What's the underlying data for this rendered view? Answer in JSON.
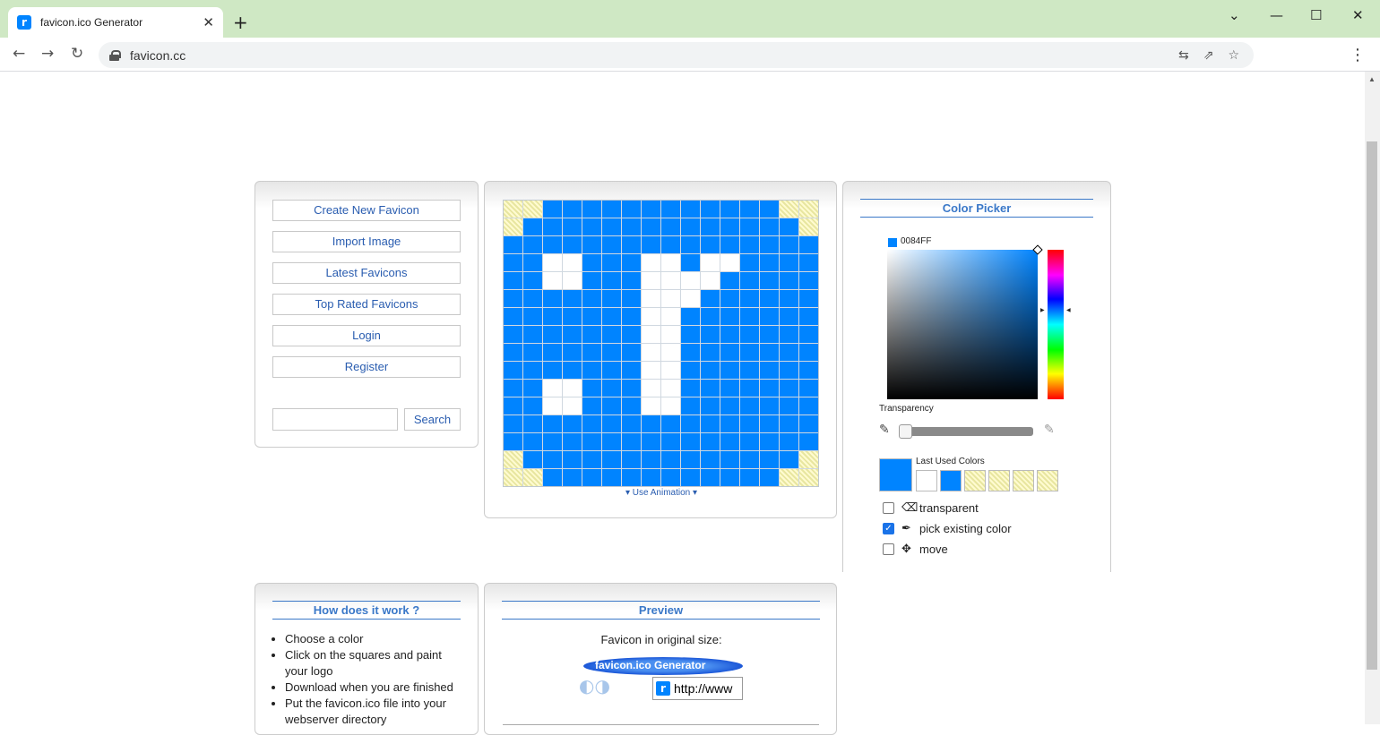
{
  "browser": {
    "tab_title": "favicon.ico Generator",
    "tab_favicon_letter": "r",
    "tab_close": "✕",
    "new_tab": "+",
    "url": "favicon.cc",
    "window_controls": {
      "tabsearch": "⌄",
      "minimize": "—",
      "maximize": "☐",
      "close": "✕"
    },
    "nav": {
      "back": "←",
      "forward": "→",
      "reload": "↻"
    },
    "omnibox_icons": [
      "translate-icon",
      "share-icon",
      "star-icon"
    ],
    "menu": "⋮"
  },
  "menu": {
    "items": [
      "Create New Favicon",
      "Import Image",
      "Latest Favicons",
      "Top Rated Favicons",
      "Login",
      "Register"
    ],
    "search_button": "Search",
    "search_value": ""
  },
  "editor": {
    "use_animation": "Use Animation",
    "pixels": [
      "TTBBBBBBBBBBBBTT",
      "TBBBBBBBBBBBBBBT",
      "BBBBBBBBBBBBBBBB",
      "BBWWBBBWWBWWBBBB",
      "BBWWBBBWWWWBBBBB",
      "BBBBBBBWWWBBBBBB",
      "BBBBBBBWWBBBBBBB",
      "BBBBBBBWWBBBBBBB",
      "BBBBBBBWWBBBBBBB",
      "BBBBBBBWWBBBBBBB",
      "BBWWBBBWWBBBBBBB",
      "BBWWBBBWWBBBBBBB",
      "BBBBBBBBBBBBBBBB",
      "BBBBBBBBBBBBBBBB",
      "TBBBBBBBBBBBBBBT",
      "TTBBBBBBBBBBBBTT"
    ],
    "colors": {
      "B": "#0084ff",
      "W": "#ffffff"
    }
  },
  "color_picker": {
    "title": "Color Picker",
    "hex": "0084FF",
    "current_color": "#0084ff",
    "transparency_label": "Transparency",
    "transparency_value": 0,
    "last_used_label": "Last Used Colors",
    "last_used": [
      "#ffffff",
      "#0084ff",
      "transparent",
      "transparent",
      "transparent",
      "transparent"
    ],
    "options": [
      {
        "label": "transparent",
        "checked": false,
        "icon": "eraser-icon"
      },
      {
        "label": "pick existing color",
        "checked": true,
        "icon": "eyedropper-icon"
      },
      {
        "label": "move",
        "checked": false,
        "icon": "move-icon"
      }
    ]
  },
  "how": {
    "title": "How does it work ?",
    "steps": [
      "Choose a color",
      "Click on the squares and paint your logo",
      "Download when you are finished",
      "Put the favicon.ico file into your webserver directory"
    ]
  },
  "preview": {
    "title": "Preview",
    "label": "Favicon in original size:",
    "browser_bar_text": "favicon.ico Generator",
    "url_text": "http://www"
  }
}
